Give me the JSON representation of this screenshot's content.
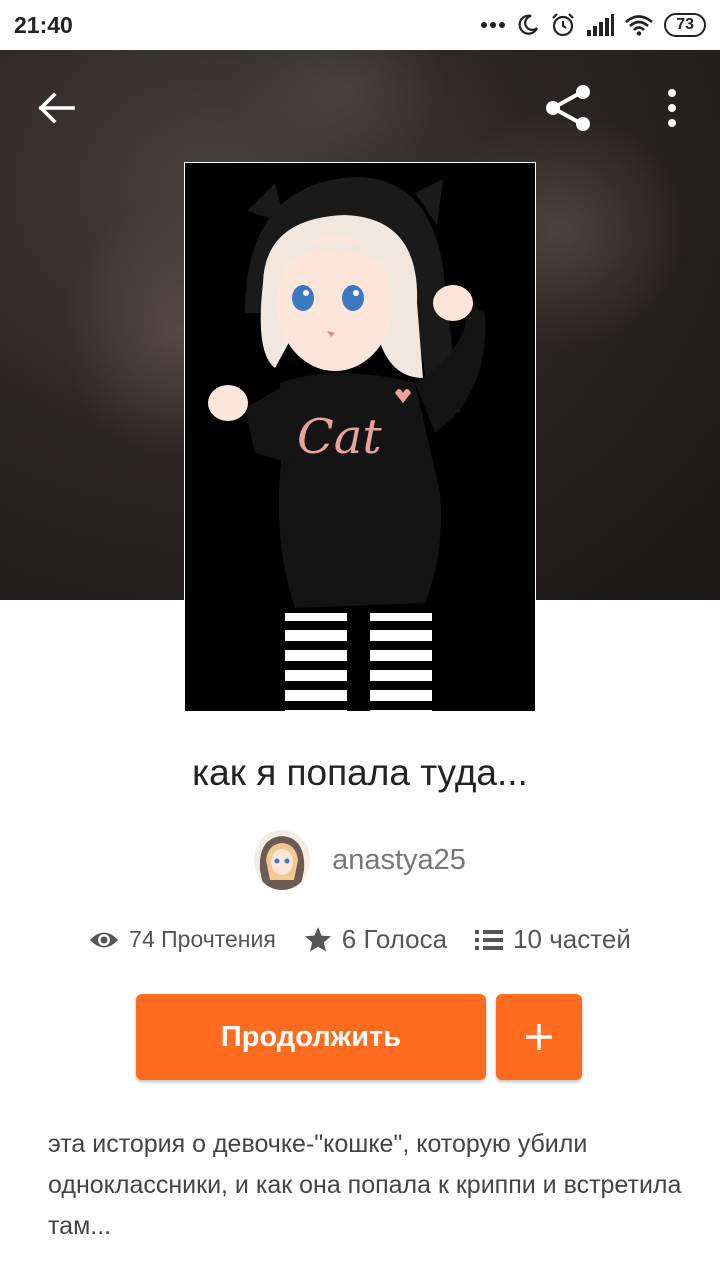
{
  "status_bar": {
    "time": "21:40",
    "battery": "73",
    "icons": [
      "dots-icon",
      "moon-icon",
      "alarm-icon",
      "signal-icon",
      "wifi-icon",
      "battery-icon"
    ]
  },
  "toolbar": {
    "back_icon": "arrow-left-icon",
    "share_icon": "share-icon",
    "more_icon": "more-vertical-icon"
  },
  "story": {
    "title": "как я попала туда...",
    "cover_text": "Cat",
    "author": "anastya25",
    "stats": {
      "reads": "74 Прочтения",
      "votes": "6 Голоса",
      "parts": "10 частей"
    },
    "description": "эта история о девочке-\"кошке\", которую убили одноклассники, и как она попала к криппи и встретила там..."
  },
  "actions": {
    "continue_label": "Продолжить",
    "add_icon": "plus-icon"
  },
  "colors": {
    "accent": "#ff6b1f",
    "header_bg": "#2b2626"
  }
}
